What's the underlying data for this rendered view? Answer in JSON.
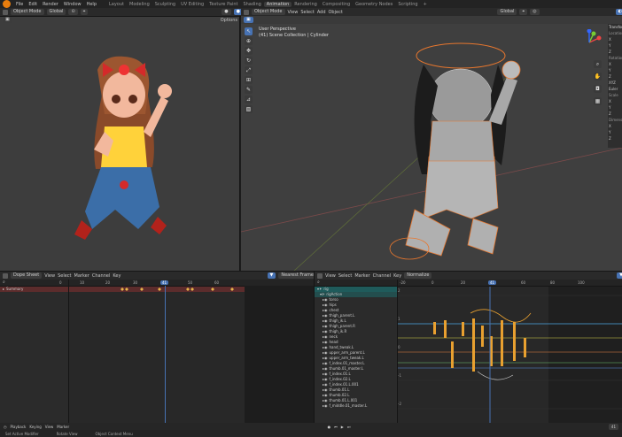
{
  "topmenu": [
    "File",
    "Edit",
    "Render",
    "Window",
    "Help"
  ],
  "workspaces": [
    "Layout",
    "Modeling",
    "Sculpting",
    "UV Editing",
    "Texture Paint",
    "Shading",
    "Animation",
    "Rendering",
    "Compositing",
    "Geometry Nodes",
    "Scripting"
  ],
  "active_workspace": "Animation",
  "left_view": {
    "mode": "Object Mode",
    "orient": "Global",
    "options": "Options"
  },
  "main_view": {
    "mode": "Object Mode",
    "menus": [
      "View",
      "Select",
      "Add",
      "Object"
    ],
    "orient": "Global",
    "persp": "User Perspective",
    "collection": "(41) Scene Collection | Cylinder"
  },
  "npanel": {
    "tab": "Transform",
    "labels": [
      "Location",
      "X",
      "Y",
      "Z",
      "Rotation",
      "X",
      "Y",
      "Z",
      "XYZ Euler",
      "Scale",
      "X",
      "Y",
      "Z",
      "Dimensions",
      "X",
      "Y",
      "Z"
    ]
  },
  "dopesheet": {
    "editor": "Dope Sheet",
    "menus": [
      "View",
      "Select",
      "Marker",
      "Channel",
      "Key"
    ],
    "interp": "Nearest Frame",
    "summary": "Summary",
    "ticks": [
      "0",
      "10",
      "20",
      "30",
      "40",
      "50",
      "60"
    ],
    "current": "41"
  },
  "graph": {
    "menus": [
      "View",
      "Select",
      "Marker",
      "Channel",
      "Key"
    ],
    "normalize": "Normalize",
    "ticks": [
      "-20",
      "0",
      "20",
      "40",
      "60",
      "80",
      "100"
    ],
    "current": "41",
    "y_labels": [
      "2",
      "1",
      "0",
      "-1",
      "-2"
    ],
    "rig": "rig",
    "pose": "rigAction",
    "bones": [
      "torso",
      "hips",
      "chest",
      "thigh_parent.L",
      "thigh_ik.L",
      "thigh_parent.R",
      "thigh_ik.R",
      "neck",
      "head",
      "hand_tweak.L",
      "upper_arm_parent.L",
      "upper_arm_tweak.L",
      "f_index.01_master.L",
      "thumb.01_master.L",
      "f_index.01.L",
      "f_index.02.L",
      "f_index.01.L.001",
      "thumb.01.L",
      "thumb.02.L",
      "thumb.01.L.001",
      "f_middle.01_master.L"
    ]
  },
  "playback": {
    "labels": [
      "Playback",
      "Keying",
      "View",
      "Marker"
    ],
    "frame": "41"
  },
  "statusbar": [
    "Set Active Modifier",
    "Rotate View",
    "Object Context Menu"
  ]
}
